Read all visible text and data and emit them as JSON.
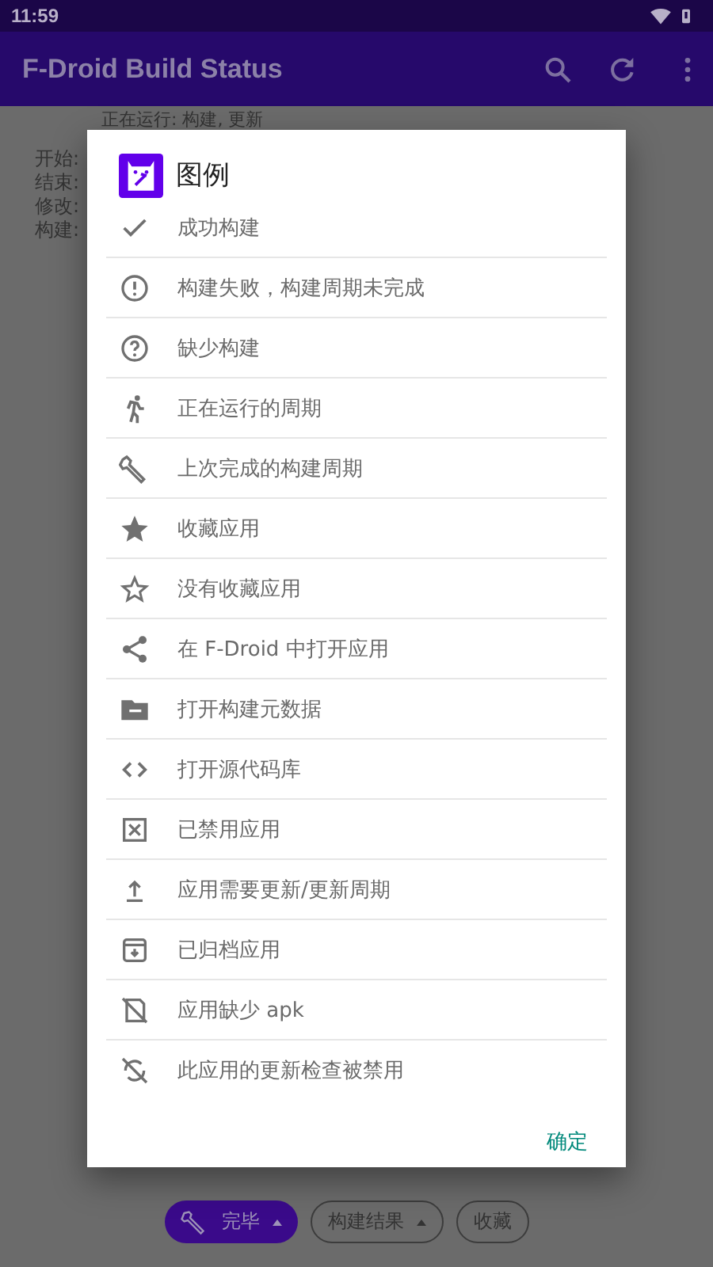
{
  "status_bar": {
    "time": "11:59"
  },
  "app_bar": {
    "title": "F-Droid Build Status"
  },
  "background": {
    "heading": "正在运行: 构建, 更新",
    "labels": [
      "开始:",
      "结束:",
      "修改:",
      "构建:"
    ]
  },
  "dialog": {
    "title": "图例",
    "items": [
      {
        "label": "成功构建"
      },
      {
        "label": "构建失败，构建周期未完成"
      },
      {
        "label": "缺少构建"
      },
      {
        "label": "正在运行的周期"
      },
      {
        "label": "上次完成的构建周期"
      },
      {
        "label": "收藏应用"
      },
      {
        "label": "没有收藏应用"
      },
      {
        "label": "在 F-Droid 中打开应用"
      },
      {
        "label": "打开构建元数据"
      },
      {
        "label": "打开源代码库"
      },
      {
        "label": "已禁用应用"
      },
      {
        "label": "应用需要更新/更新周期"
      },
      {
        "label": "已归档应用"
      },
      {
        "label": "应用缺少 apk"
      },
      {
        "label": "此应用的更新检查被禁用"
      }
    ],
    "ok_button": "确定"
  },
  "chips": [
    {
      "label": "完毕",
      "kind": "filled",
      "dropdown": true
    },
    {
      "label": "构建结果",
      "kind": "outlined",
      "dropdown": true
    },
    {
      "label": "收藏",
      "kind": "outlined",
      "dropdown": false
    }
  ]
}
